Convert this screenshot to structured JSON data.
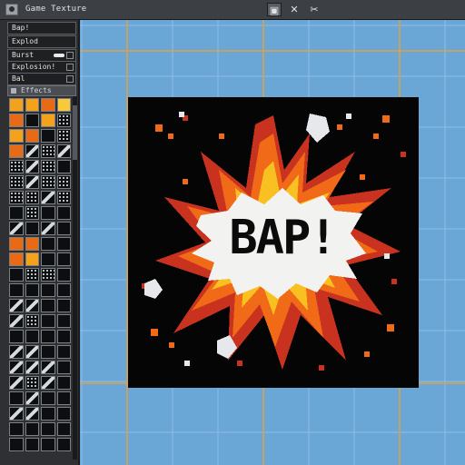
{
  "titlebar": {
    "title": "Game Texture",
    "view_icon": "frame-icon",
    "close_glyph": "✕",
    "tool_glyph": "✂"
  },
  "panel": {
    "rows": [
      {
        "label": "Bap!"
      },
      {
        "label": "Explod"
      },
      {
        "label": "Burst"
      },
      {
        "label": "Explosion!"
      },
      {
        "label": "Bal"
      }
    ],
    "palette_header": "Effects"
  },
  "canvas": {
    "art_text": "BAP!",
    "colors": {
      "background": "#6aa6d6",
      "grid": "#8fbfe4",
      "guide": "#e0a040",
      "burst_red": "#c8321e",
      "burst_orange": "#f06a18",
      "burst_yellow": "#f8c020",
      "burst_white": "#f2f2f0"
    }
  }
}
